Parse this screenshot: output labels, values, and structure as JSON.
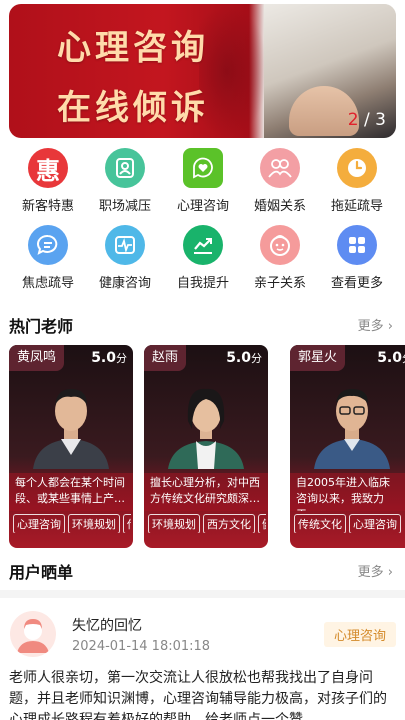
{
  "banner": {
    "title_line1": "心理咨询",
    "title_line2": "在线倾诉",
    "pager_current": "2",
    "pager_sep": " / ",
    "pager_total": "3"
  },
  "categories": [
    {
      "label": "新客特惠",
      "icon": "hui-discount-icon",
      "color": "#e8373a"
    },
    {
      "label": "职场减压",
      "icon": "office-icon",
      "color": "#47c49a"
    },
    {
      "label": "心理咨询",
      "icon": "heart-chat-icon",
      "color": "#5bc229"
    },
    {
      "label": "婚姻关系",
      "icon": "couple-icon",
      "color": "#f39fa4"
    },
    {
      "label": "拖延疏导",
      "icon": "clock-icon",
      "color": "#f4ad3d"
    },
    {
      "label": "焦虑疏导",
      "icon": "chat-bubble-icon",
      "color": "#5aa3f0"
    },
    {
      "label": "健康咨询",
      "icon": "heartbeat-icon",
      "color": "#4fb8e8"
    },
    {
      "label": "自我提升",
      "icon": "trend-up-icon",
      "color": "#19b36b"
    },
    {
      "label": "亲子关系",
      "icon": "baby-icon",
      "color": "#f59b9b"
    },
    {
      "label": "查看更多",
      "icon": "grid-more-icon",
      "color": "#5e8cf2"
    }
  ],
  "hot_teachers": {
    "title": "热门老师",
    "more": "更多",
    "teachers": [
      {
        "name": "黄凤鸣",
        "score": "5.0",
        "score_unit": "分",
        "desc": "每个人都会在某个时间段、或某些事情上产…",
        "tags": [
          "心理咨询",
          "环境规划",
          "传统文化"
        ]
      },
      {
        "name": "赵雨",
        "score": "5.0",
        "score_unit": "分",
        "desc": "擅长心理分析，对中西方传统文化研究颇深…",
        "tags": [
          "环境规划",
          "西方文化",
          "健康咨询"
        ]
      },
      {
        "name": "郭星火",
        "score": "5.0",
        "score_unit": "分",
        "desc": "自2005年进入临床咨询以来，我致力于…",
        "tags": [
          "传统文化",
          "心理咨询"
        ]
      }
    ]
  },
  "reviews": {
    "title": "用户晒单",
    "more": "更多",
    "items": [
      {
        "user": "失忆的回忆",
        "time": "2024-01-14 18:01:18",
        "tag": "心理咨询",
        "text": "老师人很亲切，第一次交流让人很放松也帮我找出了自身问题，并且老师知识渊博，心理咨询辅导能力极高，对孩子们的心理成长路程有着极好的帮助，给老师点一个赞"
      }
    ]
  }
}
